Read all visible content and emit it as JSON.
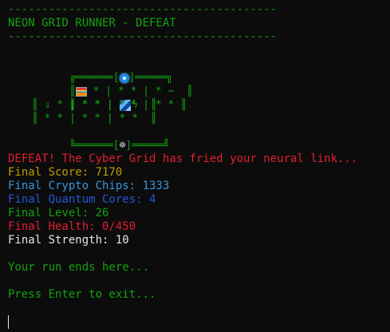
{
  "header": {
    "rule_top": "----------------------------------------",
    "title": "NEON GRID RUNNER - DEFEAT",
    "rule_bottom": "----------------------------------------"
  },
  "map": {
    "top_left": "╔══════[",
    "top_right": "]═════╗",
    "row1_a": "║",
    "row1_b": " * | * * | * ~",
    "row1_c": "  ║",
    "row2_a": "║ * * | ",
    "row2_b": "* | * *",
    "row2_c": " ║",
    "row3": "║ ⇓ * | * * | * ϟ  ║",
    "row4": "║ * * | * * | * *  ║",
    "bottom_left": "╚══════[",
    "bottom_right": "]═════╝",
    "bottom_icon": "☸",
    "icons": [
      "player-icon",
      "chest-icon",
      "gem-icon",
      "wheel-icon"
    ]
  },
  "messages": {
    "defeat": "DEFEAT! The Cyber Grid has fried your neural link...",
    "score": "Final Score: 7170",
    "chips": "Final Crypto Chips: 1333",
    "cores": "Final Quantum Cores: 4",
    "level": "Final Level: 26",
    "health": "Final Health: 0/450",
    "strength": "Final Strength: 10",
    "run_end": "Your run ends here...",
    "prompt": "Press Enter to exit..."
  },
  "colors": {
    "background": "#0c0c0c",
    "green": "#13a10e",
    "red": "#e31f2f",
    "yellow": "#c19c00",
    "cyan": "#3a96dd",
    "blue": "#2456d6",
    "white": "#e6e6e6"
  }
}
